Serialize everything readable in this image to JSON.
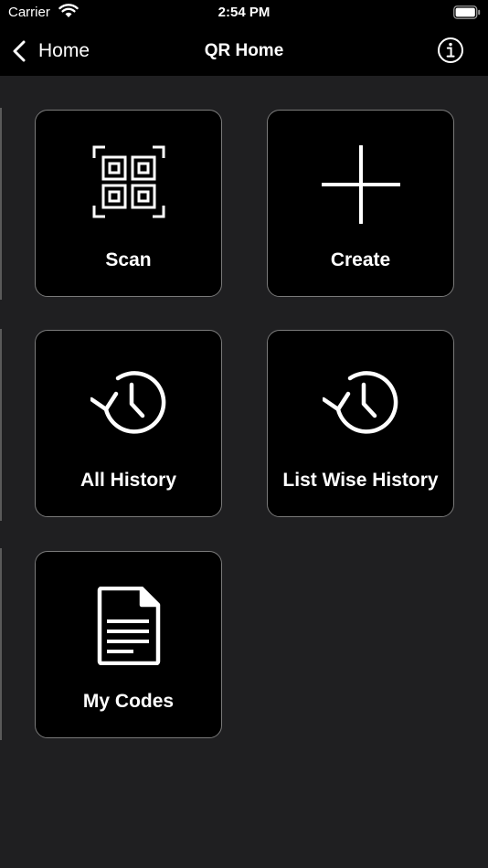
{
  "status_bar": {
    "carrier": "Carrier",
    "time": "2:54 PM"
  },
  "nav": {
    "back_label": "Home",
    "title": "QR Home"
  },
  "tiles": [
    {
      "label": "Scan",
      "icon": "qr-code-icon"
    },
    {
      "label": "Create",
      "icon": "plus-icon"
    },
    {
      "label": "All History",
      "icon": "history-icon"
    },
    {
      "label": "List Wise History",
      "icon": "history-icon"
    },
    {
      "label": "My Codes",
      "icon": "document-icon"
    }
  ],
  "colors": {
    "background": "#1f1f21",
    "bar": "#000000",
    "tile": "#000000",
    "tile_border": "#7a7a7a",
    "text": "#ffffff"
  }
}
